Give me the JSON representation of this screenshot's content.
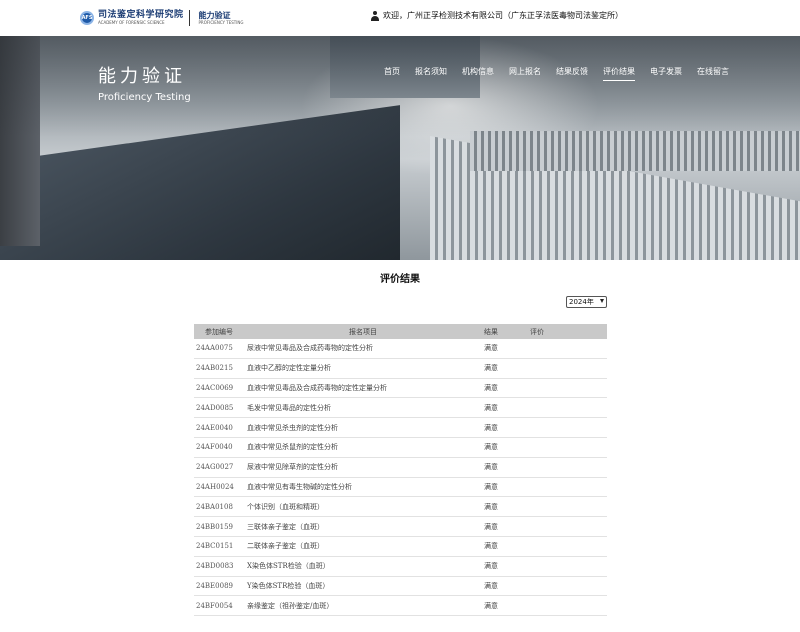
{
  "header": {
    "logo_cn": "司法鉴定科学研究院",
    "logo_en": "ACADEMY OF FORENSIC SCIENCE",
    "logo_sub_cn": "能力验证",
    "logo_sub_en": "PROFICIENCY TESTING",
    "welcome": "欢迎，广州正孚检测技术有限公司（广东正孚法医毒物司法鉴定所）"
  },
  "banner": {
    "title_cn": "能力验证",
    "title_en": "Proficiency Testing"
  },
  "nav": [
    {
      "label": "首页",
      "active": false
    },
    {
      "label": "报名须知",
      "active": false
    },
    {
      "label": "机构信息",
      "active": false
    },
    {
      "label": "网上报名",
      "active": false
    },
    {
      "label": "结果反馈",
      "active": false
    },
    {
      "label": "评价结果",
      "active": true
    },
    {
      "label": "电子发票",
      "active": false
    },
    {
      "label": "在线留言",
      "active": false
    }
  ],
  "main": {
    "title": "评价结果",
    "year_select": "2024年"
  },
  "table": {
    "headers": [
      "参加编号",
      "报名项目",
      "结果",
      "评价"
    ],
    "rows": [
      {
        "id": "24AA0075",
        "item": "尿液中常见毒品及合成药毒物的定性分析",
        "result": "满意",
        "eval": ""
      },
      {
        "id": "24AB0215",
        "item": "血液中乙醇的定性定量分析",
        "result": "满意",
        "eval": ""
      },
      {
        "id": "24AC0069",
        "item": "血液中常见毒品及合成药毒物的定性定量分析",
        "result": "满意",
        "eval": ""
      },
      {
        "id": "24AD0085",
        "item": "毛发中常见毒品的定性分析",
        "result": "满意",
        "eval": ""
      },
      {
        "id": "24AE0040",
        "item": "血液中常见杀虫剂的定性分析",
        "result": "满意",
        "eval": ""
      },
      {
        "id": "24AF0040",
        "item": "血液中常见杀鼠剂的定性分析",
        "result": "满意",
        "eval": ""
      },
      {
        "id": "24AG0027",
        "item": "尿液中常见除草剂的定性分析",
        "result": "满意",
        "eval": ""
      },
      {
        "id": "24AH0024",
        "item": "血液中常见有毒生物碱的定性分析",
        "result": "满意",
        "eval": ""
      },
      {
        "id": "24BA0108",
        "item": "个体识别（血斑和精斑）",
        "result": "满意",
        "eval": ""
      },
      {
        "id": "24BB0159",
        "item": "三联体亲子鉴定（血斑）",
        "result": "满意",
        "eval": ""
      },
      {
        "id": "24BC0151",
        "item": "二联体亲子鉴定（血斑）",
        "result": "满意",
        "eval": ""
      },
      {
        "id": "24BD0083",
        "item": "X染色体STR检验（血斑）",
        "result": "满意",
        "eval": ""
      },
      {
        "id": "24BE0089",
        "item": "Y染色体STR检验（血斑）",
        "result": "满意",
        "eval": ""
      },
      {
        "id": "24BF0054",
        "item": "亲缘鉴定（祖孙鉴定/血斑）",
        "result": "满意",
        "eval": ""
      }
    ]
  }
}
